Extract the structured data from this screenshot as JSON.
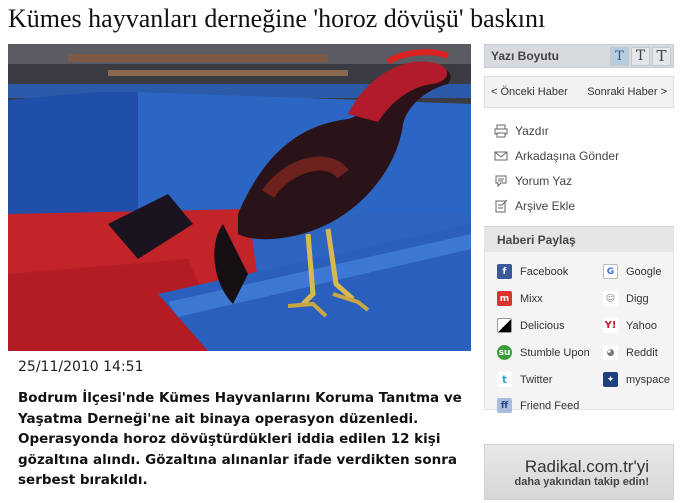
{
  "headline": "Kümes hayvanları derneğine 'horoz dövüşü' baskını",
  "date": "25/11/2010 14:51",
  "summary": "Bodrum İlçesi'nde Kümes Hayvanlarını Koruma Tanıtma ve Yaşatma Derneği'ne ait binaya operasyon düzenledi. Operasyonda horoz dövüştürdükleri iddia edilen 12 kişi gözaltına alındı. Gözaltına alınanlar ifade verdikten sonra serbest bırakıldı.",
  "font_size": {
    "label": "Yazı Boyutu",
    "buttons": [
      "T",
      "T",
      "T"
    ]
  },
  "nav": {
    "prev": "< Önceki Haber",
    "next": "Sonraki Haber >"
  },
  "actions": [
    {
      "label": "Yazdır",
      "icon": "printer-icon"
    },
    {
      "label": "Arkadaşına Gönder",
      "icon": "envelope-icon"
    },
    {
      "label": "Yorum Yaz",
      "icon": "comment-icon"
    },
    {
      "label": "Arşive Ekle",
      "icon": "archive-icon"
    }
  ],
  "share": {
    "title": "Haberi Paylaş",
    "items": [
      {
        "label": "Facebook",
        "icon": "facebook-icon",
        "color": "#3b5998"
      },
      {
        "label": "Google",
        "icon": "google-icon",
        "color": "#ffffff"
      },
      {
        "label": "Mixx",
        "icon": "mixx-icon",
        "color": "#d9342b"
      },
      {
        "label": "Digg",
        "icon": "digg-icon",
        "color": "#ffffff"
      },
      {
        "label": "Delicious",
        "icon": "delicious-icon",
        "color": "#000000"
      },
      {
        "label": "Yahoo",
        "icon": "yahoo-icon",
        "color": "#ffffff"
      },
      {
        "label": "Stumble Upon",
        "icon": "stumbleupon-icon",
        "color": "#3b9b3b"
      },
      {
        "label": "Reddit",
        "icon": "reddit-icon",
        "color": "#ffffff"
      },
      {
        "label": "Twitter",
        "icon": "twitter-icon",
        "color": "#ffffff"
      },
      {
        "label": "myspace",
        "icon": "myspace-icon",
        "color": "#1f3f7f"
      },
      {
        "label": "Friend Feed",
        "icon": "friendfeed-icon",
        "color": "#a8bde0"
      }
    ]
  },
  "promo": {
    "line1": "Radikal.com.tr'yi",
    "line2": "daha yakından takip edin!"
  }
}
